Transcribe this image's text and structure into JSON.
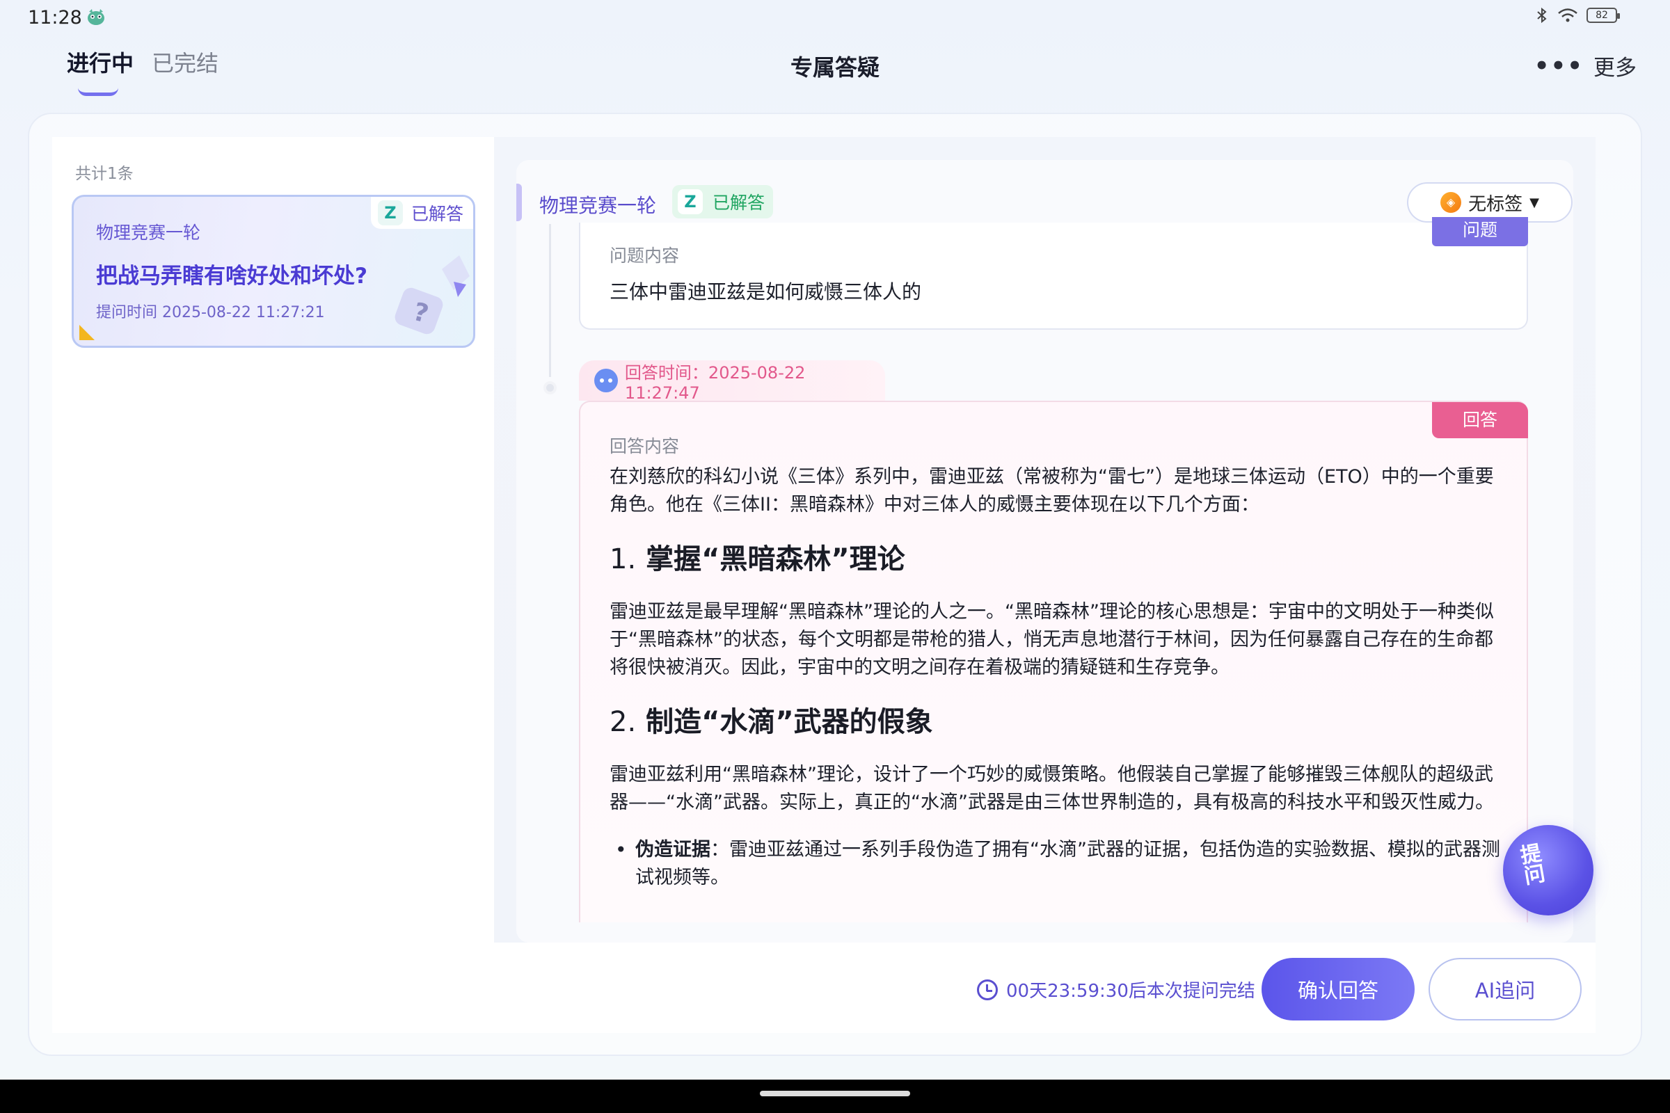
{
  "status_bar": {
    "time": "11:28",
    "battery": "82"
  },
  "header": {
    "tabs": [
      {
        "label": "进行中",
        "active": true
      },
      {
        "label": "已完结",
        "active": false
      }
    ],
    "title": "专属答疑",
    "more_label": "更多",
    "more_icon": "ellipsis-icon"
  },
  "list": {
    "count_text": "共计1条",
    "items": [
      {
        "subject": "物理竞赛一轮",
        "status": "已解答",
        "title": "把战马弄瞎有啥好处和坏处?",
        "time": "提问时间 2025-08-22 11:27:21"
      }
    ]
  },
  "detail": {
    "subject": "物理竞赛一轮",
    "status": "已解答",
    "tag_label": "无标签",
    "question": {
      "tag": "问题",
      "label": "问题内容",
      "text": "三体中雷迪亚兹是如何威慑三体人的"
    },
    "answer": {
      "time": "回答时间：2025-08-22 11:27:47",
      "tag": "回答",
      "label": "回答内容",
      "intro": "在刘慈欣的科幻小说《三体》系列中，雷迪亚兹（常被称为“雷七”）是地球三体运动（ETO）中的一个重要角色。他在《三体II：黑暗森林》中对三体人的威慑主要体现在以下几个方面：",
      "h1_num": "1.",
      "h1": "掌握“黑暗森林”理论",
      "p1": "雷迪亚兹是最早理解“黑暗森林”理论的人之一。“黑暗森林”理论的核心思想是：宇宙中的文明处于一种类似于“黑暗森林”的状态，每个文明都是带枪的猎人，悄无声息地潜行于林间，因为任何暴露自己存在的生命都将很快被消灭。因此，宇宙中的文明之间存在着极端的猜疑链和生存竞争。",
      "h2_num": "2.",
      "h2": "制造“水滴”武器的假象",
      "p2": "雷迪亚兹利用“黑暗森林”理论，设计了一个巧妙的威慑策略。他假装自己掌握了能够摧毁三体舰队的超级武器——“水滴”武器。实际上，真正的“水滴”武器是由三体世界制造的，具有极高的科技水平和毁灭性威力。",
      "bullet_bold": "伪造证据",
      "bullet_text": "：雷迪亚兹通过一系列手段伪造了拥有“水滴”武器的证据，包括伪造的实验数据、模拟的武器测试视频等。"
    }
  },
  "float_button": {
    "label": "提问"
  },
  "footer": {
    "countdown": "00天23:59:30后本次提问完结",
    "confirm_label": "确认回答",
    "ai_label": "AI追问"
  },
  "colors": {
    "accent": "#5b55ea",
    "answer_pink": "#e95f92",
    "question_purple": "#7b70e4",
    "answered_green": "#20a561"
  }
}
